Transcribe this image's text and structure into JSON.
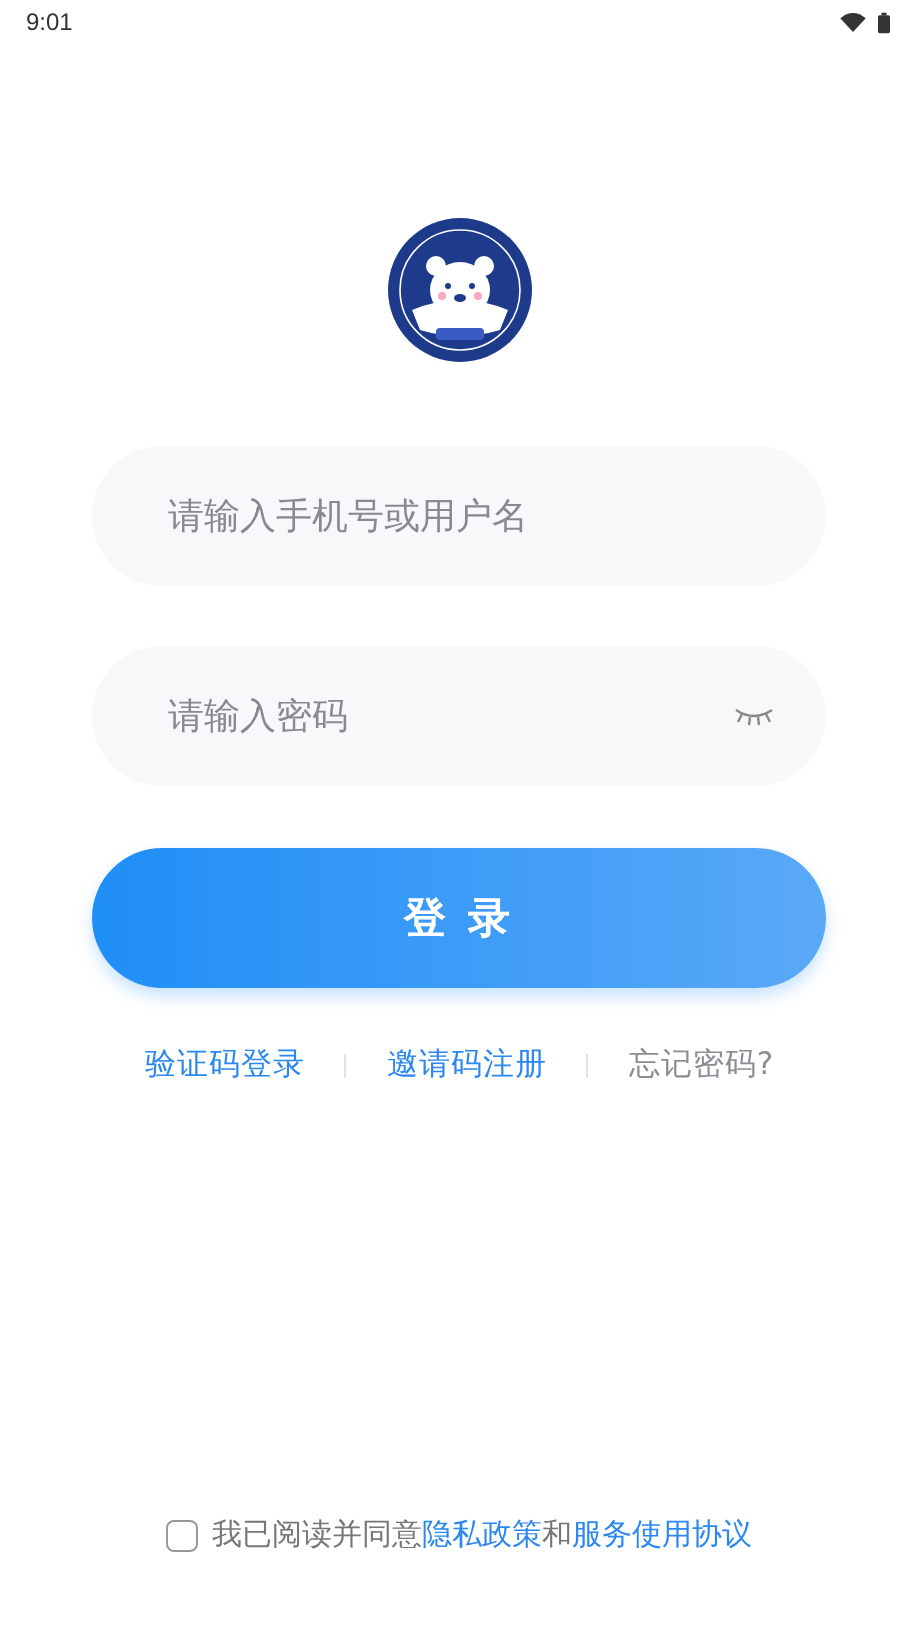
{
  "status_bar": {
    "time": "9:01"
  },
  "username_field": {
    "placeholder": "请输入手机号或用户名"
  },
  "password_field": {
    "placeholder": "请输入密码",
    "password_visible": false
  },
  "login_button": {
    "label": "登 录"
  },
  "links": [
    {
      "label": "验证码登录",
      "kind": "primary"
    },
    {
      "label": "邀请码注册",
      "kind": "primary"
    },
    {
      "label": "忘记密码?",
      "kind": "muted"
    }
  ],
  "agreement": {
    "checked": false,
    "parts": [
      {
        "text": "我已阅读并同意",
        "kind": "text"
      },
      {
        "text": "隐私政策",
        "kind": "link"
      },
      {
        "text": "和",
        "kind": "text"
      },
      {
        "text": "服务使用协议",
        "kind": "link"
      }
    ]
  }
}
